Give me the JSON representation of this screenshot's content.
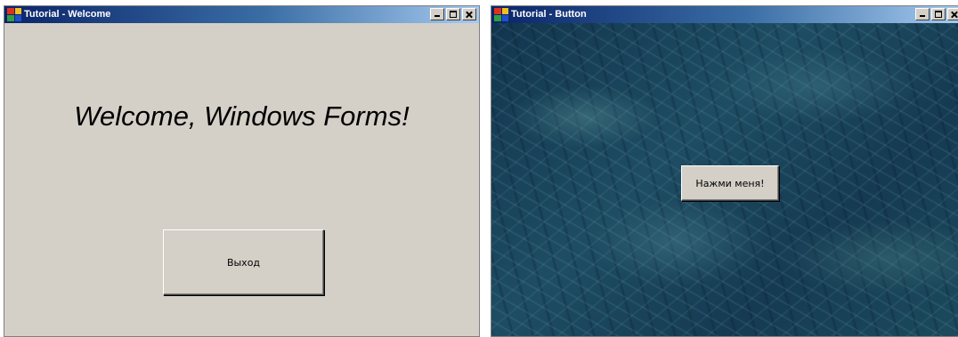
{
  "windows": [
    {
      "title": "Tutorial - Welcome",
      "controls": {
        "minimize": "_",
        "maximize": "□",
        "close": "×"
      },
      "heading": "Welcome, Windows Forms!",
      "button_label": "Выход"
    },
    {
      "title": "Tutorial - Button",
      "controls": {
        "minimize": "_",
        "maximize": "□",
        "close": "×"
      },
      "button_label": "Нажми меня!",
      "background": "dark-teal-texture"
    }
  ],
  "colors": {
    "titlebar_start": "#0a246a",
    "titlebar_end": "#a6caf0",
    "window_face": "#d4d0c8",
    "texture_base": "#1e4d63"
  },
  "icons": [
    "app-icon",
    "minimize-icon",
    "maximize-icon",
    "close-icon"
  ]
}
